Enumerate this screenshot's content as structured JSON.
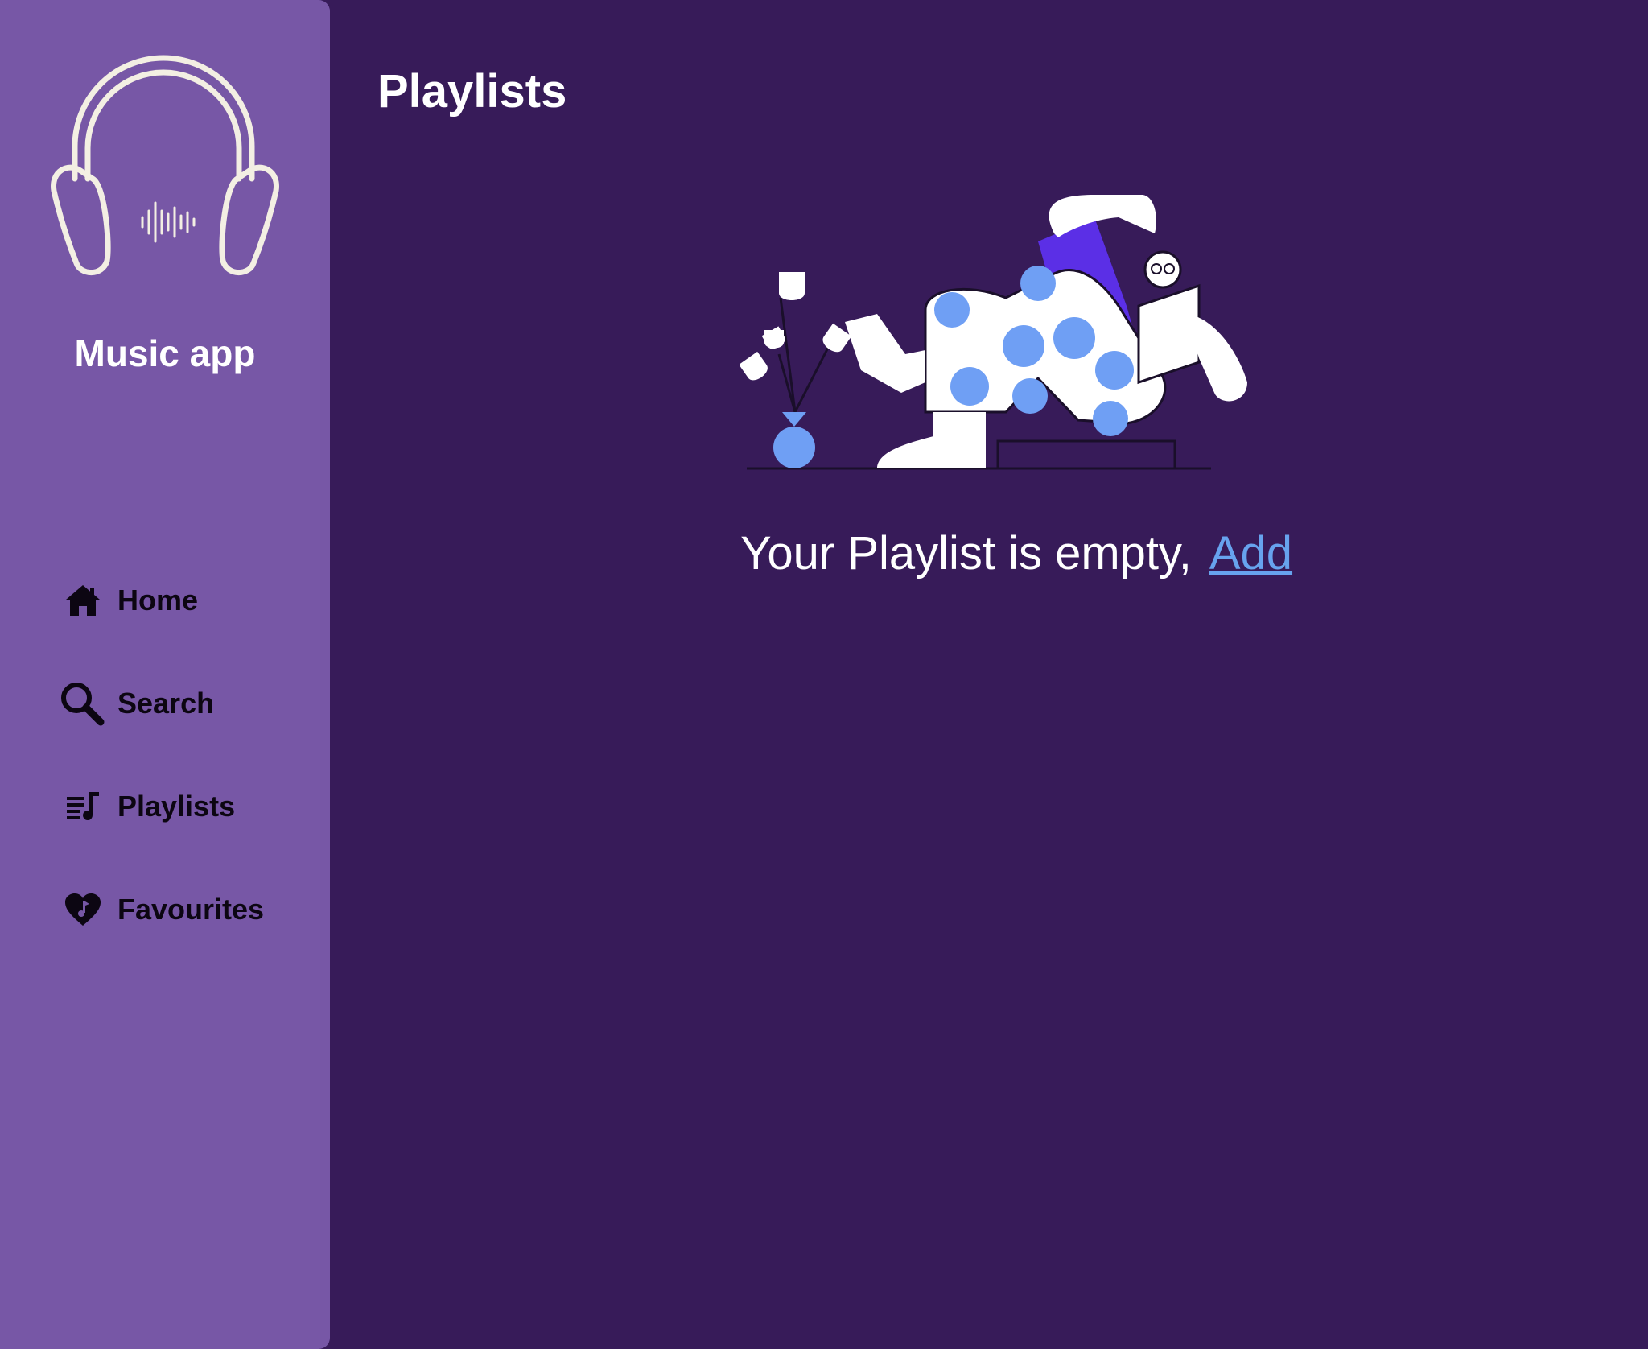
{
  "app": {
    "name": "Music app"
  },
  "nav": {
    "items": [
      {
        "label": "Home",
        "icon": "home-icon"
      },
      {
        "label": "Search",
        "icon": "search-icon"
      },
      {
        "label": "Playlists",
        "icon": "playlist-icon"
      },
      {
        "label": "Favourites",
        "icon": "heart-music-icon"
      }
    ]
  },
  "page": {
    "title": "Playlists",
    "empty_message": "Your Playlist is empty,",
    "add_label": "Add"
  },
  "colors": {
    "background": "#371b59",
    "sidebar": "#7757a6",
    "link": "#67a3ee",
    "accent_blue": "#6f9ff4",
    "accent_violet": "#5b2fe6"
  }
}
